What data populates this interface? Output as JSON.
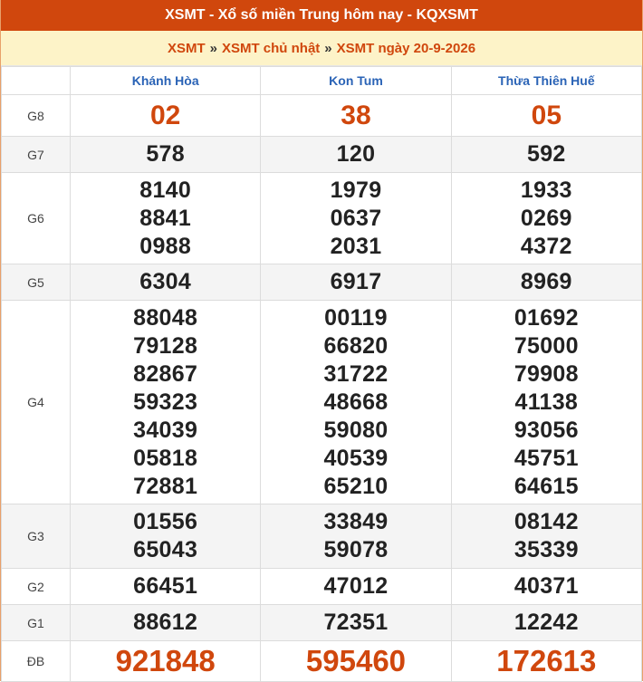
{
  "header": {
    "title": "XSMT - Xổ số miền Trung hôm nay - KQXSMT"
  },
  "breadcrumb": {
    "items": [
      "XSMT",
      "XSMT chủ nhật",
      "XSMT ngày 20-9-2026"
    ],
    "separator": "»"
  },
  "columns": [
    "Khánh Hòa",
    "Kon Tum",
    "Thừa Thiên Huế"
  ],
  "prizes": [
    {
      "label": "G8",
      "values": [
        [
          "02"
        ],
        [
          "38"
        ],
        [
          "05"
        ]
      ]
    },
    {
      "label": "G7",
      "values": [
        [
          "578"
        ],
        [
          "120"
        ],
        [
          "592"
        ]
      ]
    },
    {
      "label": "G6",
      "values": [
        [
          "8140",
          "8841",
          "0988"
        ],
        [
          "1979",
          "0637",
          "2031"
        ],
        [
          "1933",
          "0269",
          "4372"
        ]
      ]
    },
    {
      "label": "G5",
      "values": [
        [
          "6304"
        ],
        [
          "6917"
        ],
        [
          "8969"
        ]
      ]
    },
    {
      "label": "G4",
      "values": [
        [
          "88048",
          "79128",
          "82867",
          "59323",
          "34039",
          "05818",
          "72881"
        ],
        [
          "00119",
          "66820",
          "31722",
          "48668",
          "59080",
          "40539",
          "65210"
        ],
        [
          "01692",
          "75000",
          "79908",
          "41138",
          "93056",
          "45751",
          "64615"
        ]
      ]
    },
    {
      "label": "G3",
      "values": [
        [
          "01556",
          "65043"
        ],
        [
          "33849",
          "59078"
        ],
        [
          "08142",
          "35339"
        ]
      ]
    },
    {
      "label": "G2",
      "values": [
        [
          "66451"
        ],
        [
          "47012"
        ],
        [
          "40371"
        ]
      ]
    },
    {
      "label": "G1",
      "values": [
        [
          "88612"
        ],
        [
          "72351"
        ],
        [
          "12242"
        ]
      ]
    },
    {
      "label": "ĐB",
      "values": [
        [
          "921848"
        ],
        [
          "595460"
        ],
        [
          "172613"
        ]
      ]
    }
  ],
  "colors": {
    "accent": "#d0470d",
    "header_text": "#2a63b6",
    "crumb_bg": "#fdf3c8"
  }
}
